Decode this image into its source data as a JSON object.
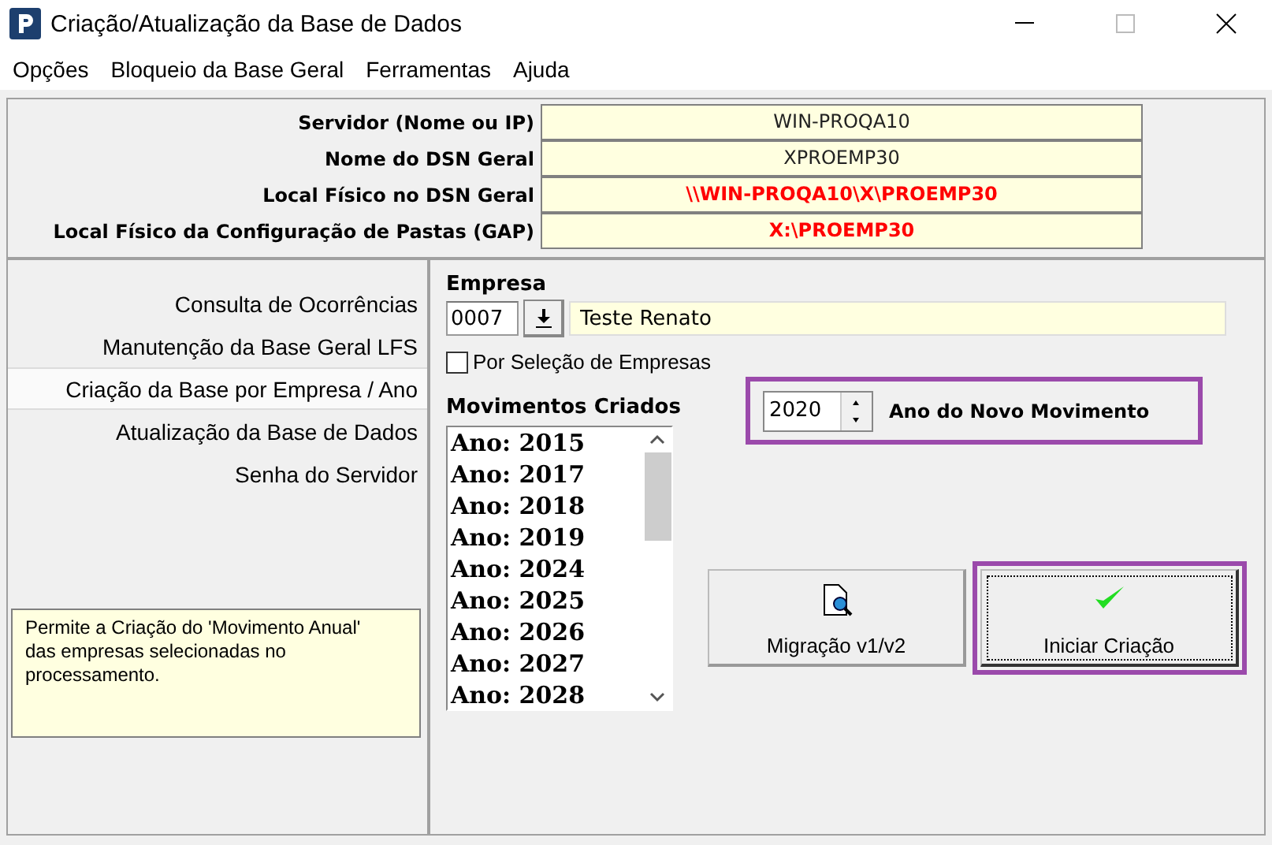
{
  "window": {
    "title": "Criação/Atualização da Base de Dados"
  },
  "menu": [
    "Opções",
    "Bloqueio da Base Geral",
    "Ferramentas",
    "Ajuda"
  ],
  "info": [
    {
      "label": "Servidor (Nome ou IP)",
      "value": "WIN-PROQA10",
      "alert": false
    },
    {
      "label": "Nome do DSN Geral",
      "value": "XPROEMP30",
      "alert": false
    },
    {
      "label": "Local Físico no DSN Geral",
      "value": "\\\\WIN-PROQA10\\X\\PROEMP30",
      "alert": true
    },
    {
      "label": "Local Físico da Configuração de Pastas (GAP)",
      "value": "X:\\PROEMP30",
      "alert": true
    }
  ],
  "sidebar": {
    "items": [
      {
        "label": "Consulta de Ocorrências",
        "selected": false
      },
      {
        "label": "Manutenção da Base Geral LFS",
        "selected": false
      },
      {
        "label": "Criação da Base por Empresa / Ano",
        "selected": true
      },
      {
        "label": "Atualização da Base de Dados",
        "selected": false
      },
      {
        "label": "Senha do Servidor",
        "selected": false
      }
    ],
    "help": "Permite a Criação do 'Movimento Anual' das empresas selecionadas no processamento."
  },
  "empresa": {
    "label": "Empresa",
    "code": "0007",
    "name": "Teste Renato"
  },
  "selection": {
    "label": "Por Seleção de Empresas",
    "checked": false
  },
  "movimentos": {
    "label": "Movimentos Criados",
    "items": [
      "Ano: 2015",
      "Ano: 2017",
      "Ano: 2018",
      "Ano: 2019",
      "Ano: 2024",
      "Ano: 2025",
      "Ano: 2026",
      "Ano: 2027",
      "Ano: 2028"
    ]
  },
  "new_year": {
    "value": "2020",
    "label": "Ano do Novo Movimento",
    "highlighted": true
  },
  "buttons": [
    {
      "label": "Migração v1/v2",
      "kind": "migrate",
      "highlighted": false,
      "focused": false
    },
    {
      "label": "Iniciar Criação",
      "kind": "start",
      "highlighted": true,
      "focused": true
    }
  ]
}
